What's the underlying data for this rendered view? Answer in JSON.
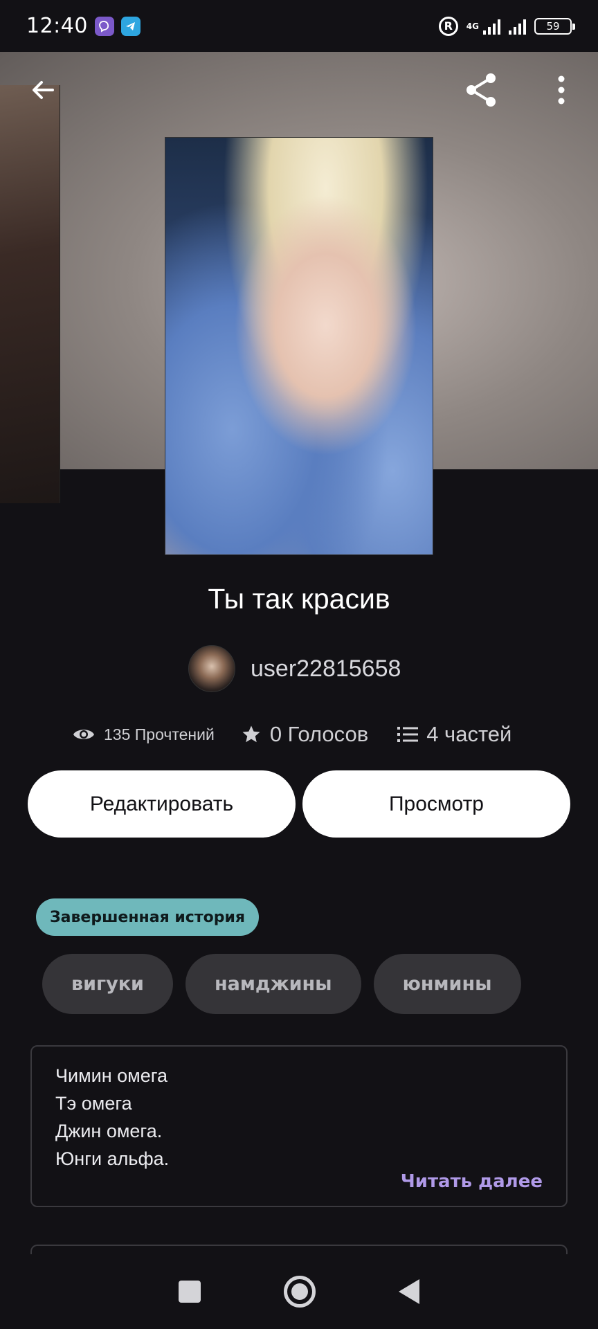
{
  "status_bar": {
    "time": "12:40",
    "network": "4G",
    "battery": "59",
    "icons": [
      "viber-icon",
      "telegram-icon",
      "registered-icon",
      "signal-icon",
      "battery-icon"
    ]
  },
  "toolbar": {
    "icons": [
      "arrow-left-icon",
      "share-icon",
      "more-vertical-icon"
    ]
  },
  "story": {
    "title": "Ты так красив",
    "author": "user22815658",
    "reads": "135 Прочтений",
    "votes": "0 Голосов",
    "parts": "4 частей",
    "status": "Завершенная история",
    "tags": [
      "вигуки",
      "намджины",
      "юнмины"
    ],
    "description": [
      "Чимин омега",
      "Тэ омега",
      "Джин омега.",
      "Юнги альфа."
    ],
    "read_more": "Читать далее"
  },
  "actions": {
    "edit_label": "Редактировать",
    "view_label": "Просмотр"
  },
  "colors": {
    "background": "#121115",
    "badge": "#6fb8bb",
    "tag_bg": "#353438",
    "link": "#b09ae8"
  }
}
